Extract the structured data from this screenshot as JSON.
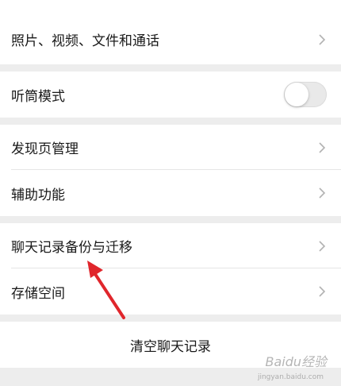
{
  "settings": {
    "items": [
      {
        "label": "照片、视频、文件和通话"
      },
      {
        "label": "听筒模式",
        "toggle": false
      },
      {
        "label": "发现页管理"
      },
      {
        "label": "辅助功能"
      },
      {
        "label": "聊天记录备份与迁移"
      },
      {
        "label": "存储空间"
      }
    ],
    "clear_chat": "清空聊天记录"
  },
  "watermark": {
    "text": "Baidu经验",
    "sub": "jingyan.baidu.com"
  },
  "colors": {
    "background": "#ededed",
    "row": "#ffffff",
    "text": "#191919",
    "chevron": "#b2b2b2",
    "arrow": "#e0262c"
  }
}
